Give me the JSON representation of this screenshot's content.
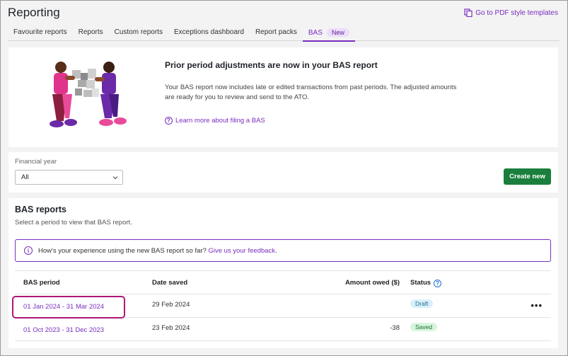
{
  "header": {
    "title": "Reporting",
    "pdf_link": "Go to PDF style templates"
  },
  "tabs": [
    {
      "label": "Favourite reports"
    },
    {
      "label": "Reports"
    },
    {
      "label": "Custom reports"
    },
    {
      "label": "Exceptions dashboard"
    },
    {
      "label": "Report packs"
    },
    {
      "label": "BAS",
      "badge": "New",
      "active": true
    }
  ],
  "banner": {
    "title": "Prior period adjustments are now in your BAS report",
    "body": "Your BAS report now includes late or edited transactions from past periods. The adjusted amounts are ready for you to review and send to the ATO.",
    "link": "Learn more about filing a BAS"
  },
  "filter": {
    "label": "Financial year",
    "value": "All",
    "create_label": "Create new"
  },
  "reports": {
    "title": "BAS reports",
    "subtitle": "Select a period to view that BAS report.",
    "feedback_text": "How's your experience using the new BAS report so far?",
    "feedback_link": "Give us your feedback",
    "feedback_end": ".",
    "columns": {
      "period": "BAS period",
      "date": "Date saved",
      "amount": "Amount owed ($)",
      "status": "Status"
    },
    "rows": [
      {
        "period": "01 Jan 2024 - 31 Mar 2024",
        "date": "29 Feb 2024",
        "amount": "",
        "status": "Draft"
      },
      {
        "period": "01 Oct 2023 - 31 Dec 2023",
        "date": "23 Feb 2024",
        "amount": "-38",
        "status": "Saved"
      }
    ],
    "more_label": "•••"
  },
  "colors": {
    "accent": "#7a2ec0",
    "primary_button": "#1a7f3c",
    "highlight": "#b0157b"
  }
}
